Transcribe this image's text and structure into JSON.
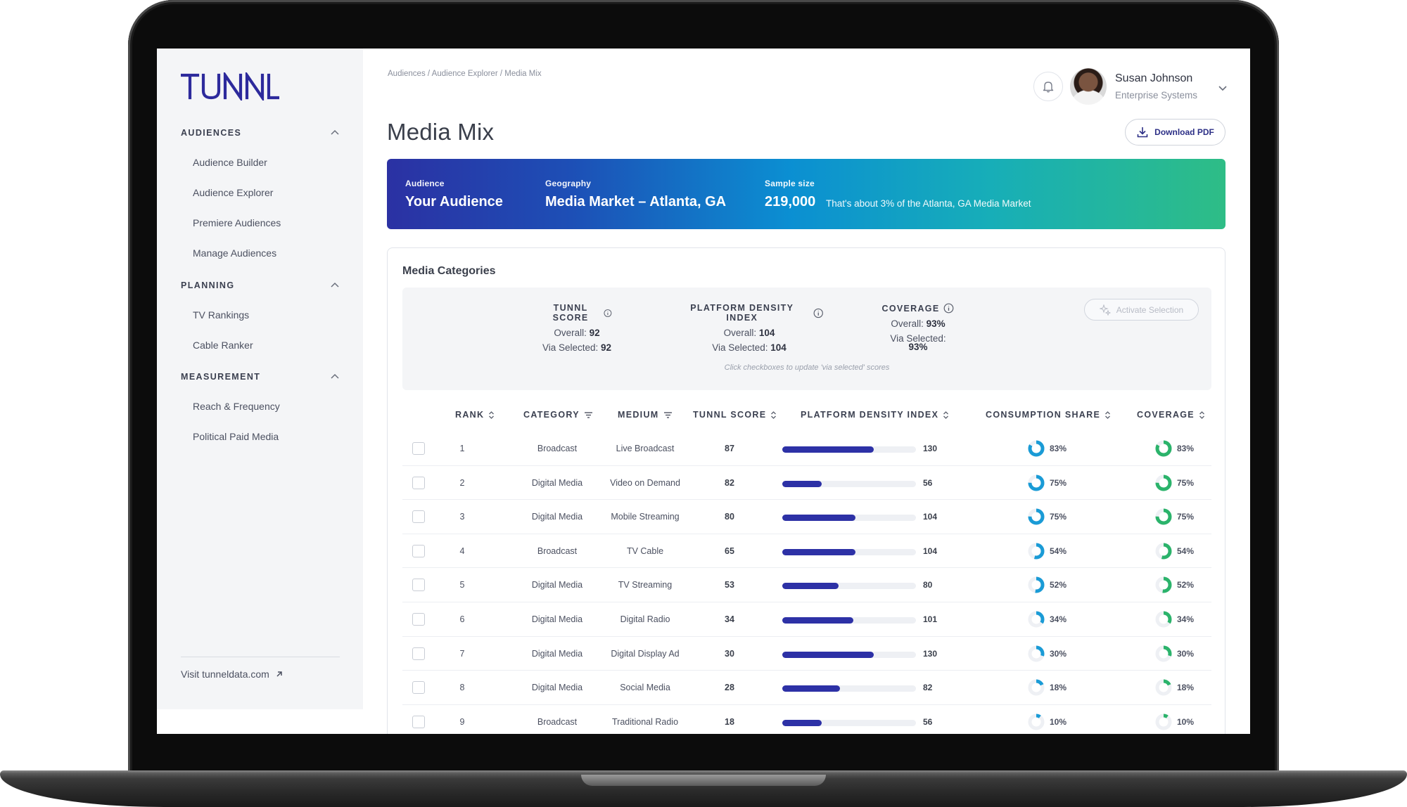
{
  "brand": {
    "logo_text": "TUNNL",
    "color": "#2d2a9c"
  },
  "sidebar": {
    "groups": [
      {
        "heading": "AUDIENCES",
        "items": [
          "Audience Builder",
          "Audience Explorer",
          "Premiere Audiences",
          "Manage Audiences"
        ]
      },
      {
        "heading": "PLANNING",
        "items": [
          "TV Rankings",
          "Cable Ranker"
        ]
      },
      {
        "heading": "MEASUREMENT",
        "items": [
          "Reach & Frequency",
          "Political Paid Media"
        ]
      }
    ],
    "visit_link": "Visit tunneldata.com"
  },
  "breadcrumb": [
    "Audiences",
    "Audience Explorer",
    "Media Mix"
  ],
  "page_title": "Media Mix",
  "user": {
    "name": "Susan Johnson",
    "org": "Enterprise Systems"
  },
  "download_button": "Download PDF",
  "hero": {
    "audience_label": "Audience",
    "audience_value": "Your Audience",
    "geography_label": "Geography",
    "geography_value": "Media Market – Atlanta, GA",
    "sample_label": "Sample size",
    "sample_value": "219,000",
    "sample_note": "That's about 3% of the Atlanta, GA Media Market"
  },
  "card": {
    "title": "Media Categories",
    "metrics": [
      {
        "name": "TUNNL SCORE",
        "overall_label": "Overall:",
        "overall": "92",
        "selected_label": "Via Selected:",
        "selected": "92"
      },
      {
        "name": "PLATFORM DENSITY INDEX",
        "overall_label": "Overall:",
        "overall": "104",
        "selected_label": "Via Selected:",
        "selected": "104"
      },
      {
        "name": "COVERAGE",
        "overall_label": "Overall:",
        "overall": "93%",
        "selected_label": "Via Selected:",
        "selected": "93%"
      }
    ],
    "hint": "Click checkboxes to update 'via selected' scores",
    "activate_button": "Activate Selection"
  },
  "table": {
    "headers": {
      "rank": "RANK",
      "category": "CATEGORY",
      "medium": "MEDIUM",
      "tunnl_score": "TUNNL SCORE",
      "density": "PLATFORM DENSITY INDEX",
      "consumption": "CONSUMPTION SHARE",
      "coverage": "COVERAGE"
    },
    "density_max": 190,
    "rows": [
      {
        "rank": "1",
        "category": "Broadcast",
        "medium": "Live Broadcast",
        "score": "87",
        "density": 130,
        "consumption": 83,
        "coverage": 83
      },
      {
        "rank": "2",
        "category": "Digital Media",
        "medium": "Video on Demand",
        "score": "82",
        "density": 56,
        "consumption": 75,
        "coverage": 75
      },
      {
        "rank": "3",
        "category": "Digital Media",
        "medium": "Mobile Streaming",
        "score": "80",
        "density": 104,
        "consumption": 75,
        "coverage": 75
      },
      {
        "rank": "4",
        "category": "Broadcast",
        "medium": "TV Cable",
        "score": "65",
        "density": 104,
        "consumption": 54,
        "coverage": 54
      },
      {
        "rank": "5",
        "category": "Digital Media",
        "medium": "TV Streaming",
        "score": "53",
        "density": 80,
        "consumption": 52,
        "coverage": 52
      },
      {
        "rank": "6",
        "category": "Digital Media",
        "medium": "Digital Radio",
        "score": "34",
        "density": 101,
        "consumption": 34,
        "coverage": 34
      },
      {
        "rank": "7",
        "category": "Digital Media",
        "medium": "Digital Display Ad",
        "score": "30",
        "density": 130,
        "consumption": 30,
        "coverage": 30
      },
      {
        "rank": "8",
        "category": "Digital Media",
        "medium": "Social Media",
        "score": "28",
        "density": 82,
        "consumption": 18,
        "coverage": 18
      },
      {
        "rank": "9",
        "category": "Broadcast",
        "medium": "Traditional Radio",
        "score": "18",
        "density": 56,
        "consumption": 10,
        "coverage": 10
      }
    ],
    "consumption_color": "#1a9bd6",
    "coverage_color": "#2bb36b",
    "bar_color": "#2d31a6"
  }
}
